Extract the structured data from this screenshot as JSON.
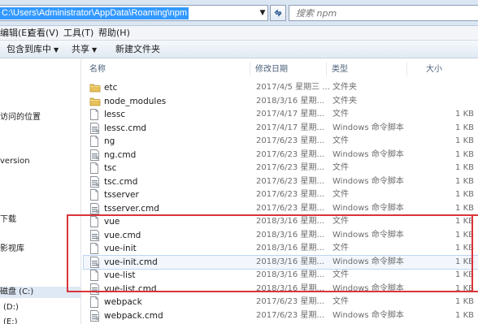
{
  "address_bar": {
    "path": "C:\\Users\\Administrator\\AppData\\Roaming\\npm",
    "search_placeholder": "搜索 npm"
  },
  "menu": [
    "编辑(E)",
    "查看(V)",
    "工具(T)",
    "帮助(H)"
  ],
  "toolbar": {
    "include_library": "包含到库中",
    "share": "共享",
    "new_folder": "新建文件夹"
  },
  "nav": [
    "访问的位置",
    "version",
    "下载",
    "影视库",
    "磁盘 (C:)",
    "(D:)",
    "(E:)"
  ],
  "columns": {
    "name": "名称",
    "date": "修改日期",
    "type": "类型",
    "size": "大小"
  },
  "files": [
    {
      "name": "etc",
      "date": "2017/4/5 星期三 ...",
      "type": "文件夹",
      "size": "",
      "icon": "folder-icon"
    },
    {
      "name": "node_modules",
      "date": "2018/3/16 星期...",
      "type": "文件夹",
      "size": "",
      "icon": "folder-icon"
    },
    {
      "name": "lessc",
      "date": "2017/4/17 星期...",
      "type": "文件",
      "size": "1 KB",
      "icon": "file-icon"
    },
    {
      "name": "lessc.cmd",
      "date": "2017/4/17 星期...",
      "type": "Windows 命令脚本",
      "size": "1 KB",
      "icon": "cmd-file-icon"
    },
    {
      "name": "ng",
      "date": "2017/6/23 星期...",
      "type": "文件",
      "size": "1 KB",
      "icon": "file-icon"
    },
    {
      "name": "ng.cmd",
      "date": "2017/6/23 星期...",
      "type": "Windows 命令脚本",
      "size": "1 KB",
      "icon": "cmd-file-icon"
    },
    {
      "name": "tsc",
      "date": "2017/6/23 星期...",
      "type": "文件",
      "size": "1 KB",
      "icon": "file-icon"
    },
    {
      "name": "tsc.cmd",
      "date": "2017/6/23 星期...",
      "type": "Windows 命令脚本",
      "size": "1 KB",
      "icon": "cmd-file-icon"
    },
    {
      "name": "tsserver",
      "date": "2017/6/23 星期...",
      "type": "文件",
      "size": "1 KB",
      "icon": "file-icon"
    },
    {
      "name": "tsserver.cmd",
      "date": "2017/6/23 星期...",
      "type": "Windows 命令脚本",
      "size": "1 KB",
      "icon": "cmd-file-icon"
    },
    {
      "name": "vue",
      "date": "2018/3/16 星期...",
      "type": "文件",
      "size": "1 KB",
      "icon": "file-icon"
    },
    {
      "name": "vue.cmd",
      "date": "2018/3/16 星期...",
      "type": "Windows 命令脚本",
      "size": "1 KB",
      "icon": "cmd-file-icon"
    },
    {
      "name": "vue-init",
      "date": "2018/3/16 星期...",
      "type": "文件",
      "size": "1 KB",
      "icon": "file-icon"
    },
    {
      "name": "vue-init.cmd",
      "date": "2018/3/16 星期...",
      "type": "Windows 命令脚本",
      "size": "1 KB",
      "icon": "cmd-file-icon"
    },
    {
      "name": "vue-list",
      "date": "2018/3/16 星期...",
      "type": "文件",
      "size": "1 KB",
      "icon": "file-icon"
    },
    {
      "name": "vue-list.cmd",
      "date": "2018/3/16 星期...",
      "type": "Windows 命令脚本",
      "size": "1 KB",
      "icon": "cmd-file-icon"
    },
    {
      "name": "webpack",
      "date": "2017/6/23 星期...",
      "type": "文件",
      "size": "1 KB",
      "icon": "file-icon"
    },
    {
      "name": "webpack.cmd",
      "date": "2017/6/23 星期...",
      "type": "Windows 命令脚本",
      "size": "1 KB",
      "icon": "cmd-file-icon"
    }
  ],
  "colors": {
    "highlight_border": "#d9343a",
    "address_selection": "#3399ff",
    "folder": "#e8c15a"
  }
}
